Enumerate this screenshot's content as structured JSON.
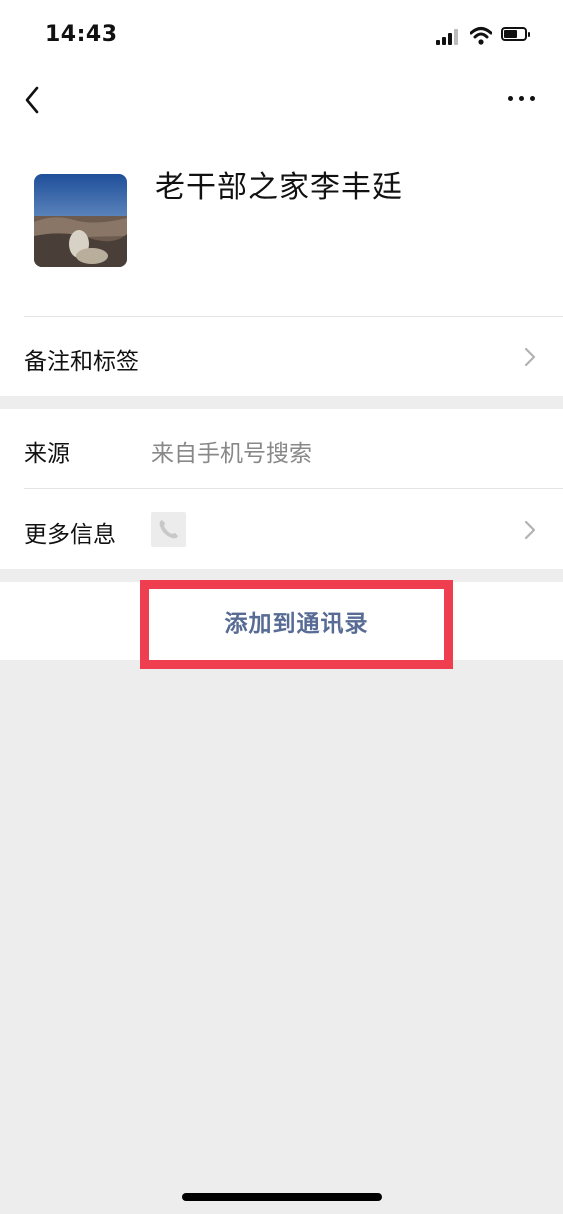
{
  "status_bar": {
    "time": "14:43",
    "signal_icon": "cellular-signal-icon",
    "wifi_icon": "wifi-icon",
    "battery_icon": "battery-icon",
    "battery_level": 0.5
  },
  "nav": {
    "back_icon": "chevron-left-icon",
    "more_icon": "more-dots-icon"
  },
  "profile": {
    "name": "老干部之家李丰廷",
    "avatar_icon": "landscape-avatar"
  },
  "rows": {
    "remarks_tags": {
      "label": "备注和标签",
      "chevron_icon": "chevron-right-icon"
    },
    "source": {
      "label": "来源",
      "value": "来自手机号搜索"
    },
    "more_info": {
      "label": "更多信息",
      "phone_icon": "phone-icon",
      "chevron_icon": "chevron-right-icon"
    }
  },
  "actions": {
    "add_to_contacts_label": "添加到通讯录",
    "link_color": "#576b95",
    "highlight_color": "#ef3e4f"
  }
}
